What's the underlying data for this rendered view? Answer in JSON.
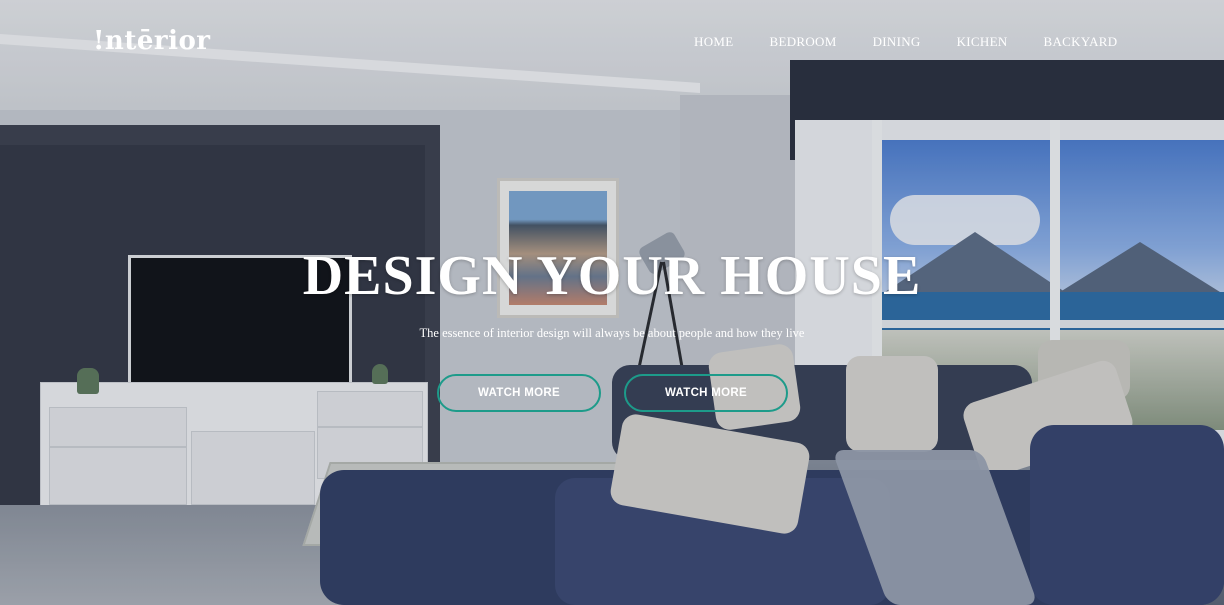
{
  "brand": {
    "logo_text": "!ntērior"
  },
  "nav": {
    "items": [
      {
        "label": "HOME"
      },
      {
        "label": "BEDROOM"
      },
      {
        "label": "DINING"
      },
      {
        "label": "KICHEN"
      },
      {
        "label": "BACKYARD"
      }
    ]
  },
  "hero": {
    "title": "DESIGN YOUR HOUSE",
    "subtitle": "The essence of interior design will always be about people and how they live",
    "buttons": [
      {
        "label": "WATCH MORE"
      },
      {
        "label": "WATCH MORE"
      }
    ],
    "button_border_color": "#1d9b8a",
    "background_image": "living-room-photo"
  }
}
